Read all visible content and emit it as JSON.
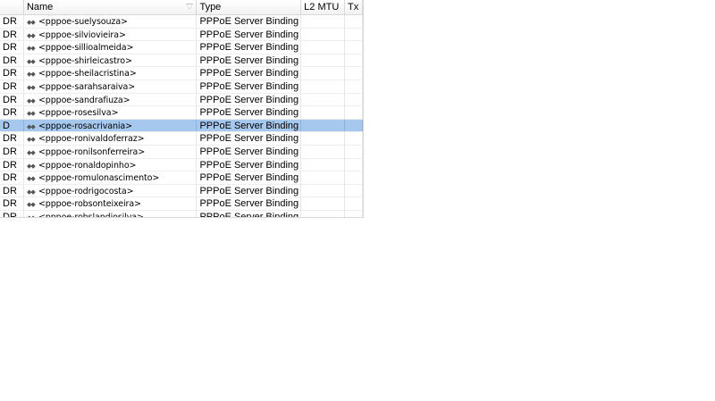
{
  "columns": {
    "flags": "",
    "name": "Name",
    "type": "Type",
    "l2mtu": "L2 MTU",
    "tx": "Tx"
  },
  "icons": {
    "sort": "sort-down-icon",
    "interface": "pppoe-interface-icon"
  },
  "colors": {
    "selection": "#a6c8ee"
  },
  "rows": [
    {
      "flags": "DR",
      "name": "<pppoe-suelysouza>",
      "type": "PPPoE Server Binding",
      "l2mtu": "",
      "tx": ""
    },
    {
      "flags": "DR",
      "name": "<pppoe-silviovieira>",
      "type": "PPPoE Server Binding",
      "l2mtu": "",
      "tx": ""
    },
    {
      "flags": "DR",
      "name": "<pppoe-sillioalmeida>",
      "type": "PPPoE Server Binding",
      "l2mtu": "",
      "tx": ""
    },
    {
      "flags": "DR",
      "name": "<pppoe-shirleicastro>",
      "type": "PPPoE Server Binding",
      "l2mtu": "",
      "tx": ""
    },
    {
      "flags": "DR",
      "name": "<pppoe-sheilacristina>",
      "type": "PPPoE Server Binding",
      "l2mtu": "",
      "tx": ""
    },
    {
      "flags": "DR",
      "name": "<pppoe-sarahsaraiva>",
      "type": "PPPoE Server Binding",
      "l2mtu": "",
      "tx": ""
    },
    {
      "flags": "DR",
      "name": "<pppoe-sandrafiuza>",
      "type": "PPPoE Server Binding",
      "l2mtu": "",
      "tx": ""
    },
    {
      "flags": "DR",
      "name": "<pppoe-rosesilva>",
      "type": "PPPoE Server Binding",
      "l2mtu": "",
      "tx": ""
    },
    {
      "flags": "D",
      "name": "<pppoe-rosacrivania>",
      "type": "PPPoE Server Binding",
      "l2mtu": "",
      "tx": "",
      "selected": true
    },
    {
      "flags": "DR",
      "name": "<pppoe-ronivaldoferraz>",
      "type": "PPPoE Server Binding",
      "l2mtu": "",
      "tx": ""
    },
    {
      "flags": "DR",
      "name": "<pppoe-ronilsonferreira>",
      "type": "PPPoE Server Binding",
      "l2mtu": "",
      "tx": ""
    },
    {
      "flags": "DR",
      "name": "<pppoe-ronaldopinho>",
      "type": "PPPoE Server Binding",
      "l2mtu": "",
      "tx": ""
    },
    {
      "flags": "DR",
      "name": "<pppoe-romulonascimento>",
      "type": "PPPoE Server Binding",
      "l2mtu": "",
      "tx": ""
    },
    {
      "flags": "DR",
      "name": "<pppoe-rodrigocosta>",
      "type": "PPPoE Server Binding",
      "l2mtu": "",
      "tx": ""
    },
    {
      "flags": "DR",
      "name": "<pppoe-robsonteixeira>",
      "type": "PPPoE Server Binding",
      "l2mtu": "",
      "tx": ""
    },
    {
      "flags": "DR",
      "name": "<pppoe-robslandiosilva>",
      "type": "PPPoE Server Binding",
      "l2mtu": "",
      "tx": ""
    }
  ]
}
